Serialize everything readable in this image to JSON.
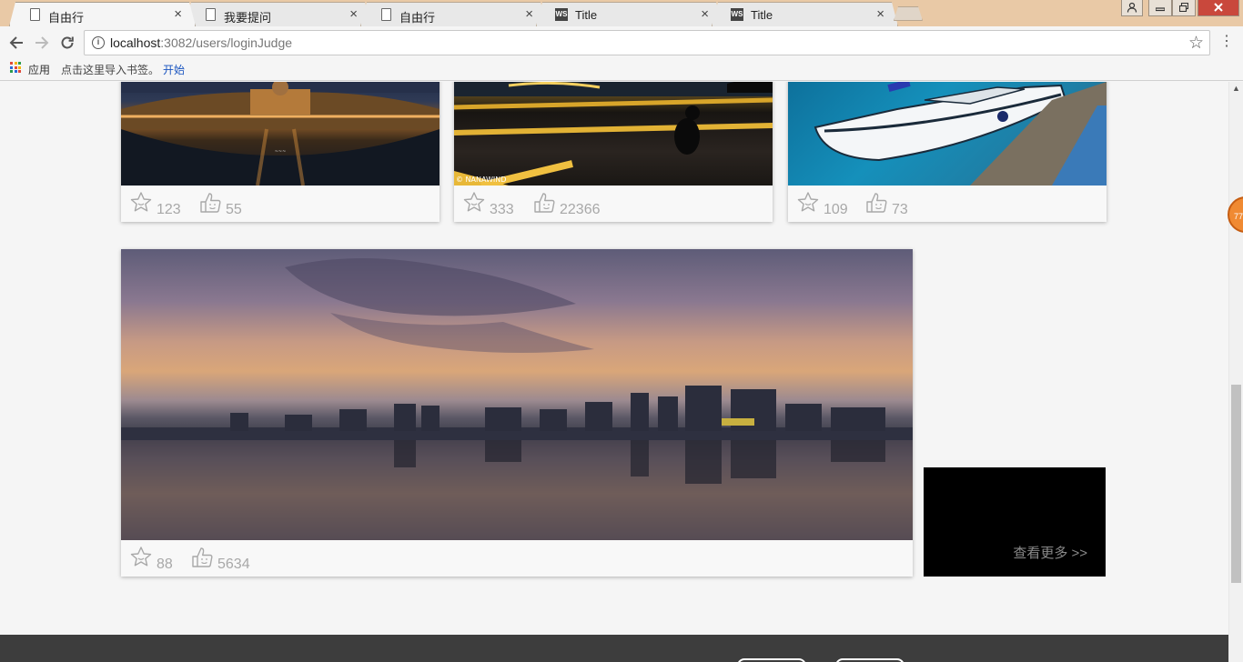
{
  "tabs": [
    {
      "title": "自由行",
      "icon": "page-icon",
      "active": true
    },
    {
      "title": "我要提问",
      "icon": "page-icon",
      "active": false
    },
    {
      "title": "自由行",
      "icon": "page-icon",
      "active": false
    },
    {
      "title": "Title",
      "icon": "ws-icon",
      "active": false
    },
    {
      "title": "Title",
      "icon": "ws-icon",
      "active": false
    }
  ],
  "tab_close_glyph": "×",
  "ws_icon_text": "WS",
  "address": {
    "host": "localhost",
    "path": ":3082/users/loginJudge"
  },
  "bookmarks": {
    "apps_label": "应用",
    "hint": "点击这里导入书签。",
    "start_link": "开始"
  },
  "cards": [
    {
      "stars": "123",
      "likes": "55"
    },
    {
      "stars": "333",
      "likes": "22366",
      "watermark": "© NANAWIND"
    },
    {
      "stars": "109",
      "likes": "73"
    },
    {
      "stars": "88",
      "likes": "5634"
    }
  ],
  "more": {
    "label": "查看更多 >>"
  },
  "floating_badge": "77",
  "colors": {
    "tab_strip": "#e9c9a6",
    "footer": "#3d3d3d",
    "stat_gray": "#a8a8a8",
    "close_button": "#c9483c",
    "badge": "#f08a32"
  }
}
